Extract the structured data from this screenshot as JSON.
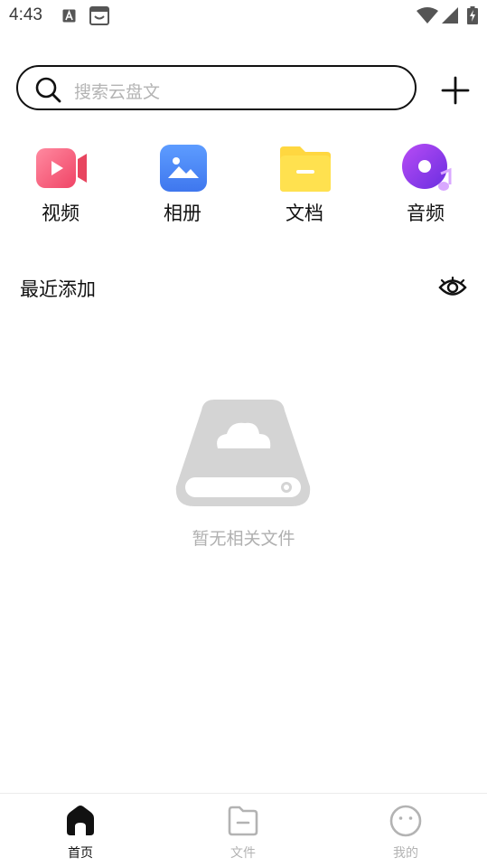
{
  "status_bar": {
    "time": "4:43",
    "icons": [
      "text-notification-icon",
      "store-notification-icon",
      "wifi-icon",
      "signal-icon",
      "battery-charging-icon"
    ]
  },
  "search": {
    "placeholder": "搜索云盘文",
    "icon": "search-icon",
    "add_icon": "plus-icon"
  },
  "categories": [
    {
      "label": "视频",
      "icon": "video-camera-icon",
      "color": "#f2546e"
    },
    {
      "label": "相册",
      "icon": "photo-album-icon",
      "color": "#4f8cf7"
    },
    {
      "label": "文档",
      "icon": "folder-document-icon",
      "color": "#ffd740"
    },
    {
      "label": "音频",
      "icon": "music-disc-icon",
      "color": "#8a35e8"
    }
  ],
  "recent": {
    "title": "最近添加",
    "toggle_icon": "eye-icon"
  },
  "empty_state": {
    "text": "暂无相关文件",
    "icon": "cloud-drive-icon"
  },
  "bottom_nav": [
    {
      "label": "首页",
      "icon": "home-icon",
      "active": true
    },
    {
      "label": "文件",
      "icon": "file-icon",
      "active": false
    },
    {
      "label": "我的",
      "icon": "profile-face-icon",
      "active": false
    }
  ],
  "colors": {
    "active_nav": "#111111",
    "inactive_nav": "#b3b3b3",
    "placeholder": "#b4b4b4"
  }
}
